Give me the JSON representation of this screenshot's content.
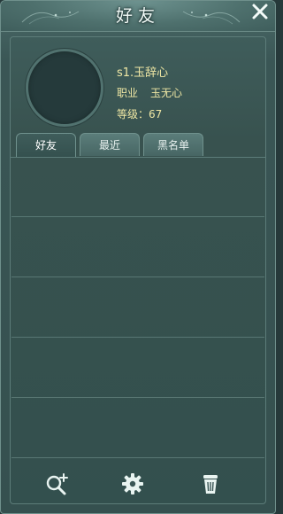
{
  "window": {
    "title": "好友"
  },
  "profile": {
    "name": "s1.玉辞心",
    "job_label": "职业",
    "job_value": "玉无心",
    "level_text": "等级：67"
  },
  "tabs": [
    {
      "label": "好友",
      "active": true
    },
    {
      "label": "最近",
      "active": false
    },
    {
      "label": "黑名单",
      "active": false
    }
  ],
  "friend_list": {
    "rows": [
      {},
      {},
      {},
      {},
      {}
    ]
  },
  "toolbar": {
    "icons": [
      "add-friend-icon",
      "gear-icon",
      "trash-icon"
    ]
  },
  "colors": {
    "accent_text": "#efe7a4",
    "panel": "#35504f",
    "title_text": "#f2fbf8"
  }
}
